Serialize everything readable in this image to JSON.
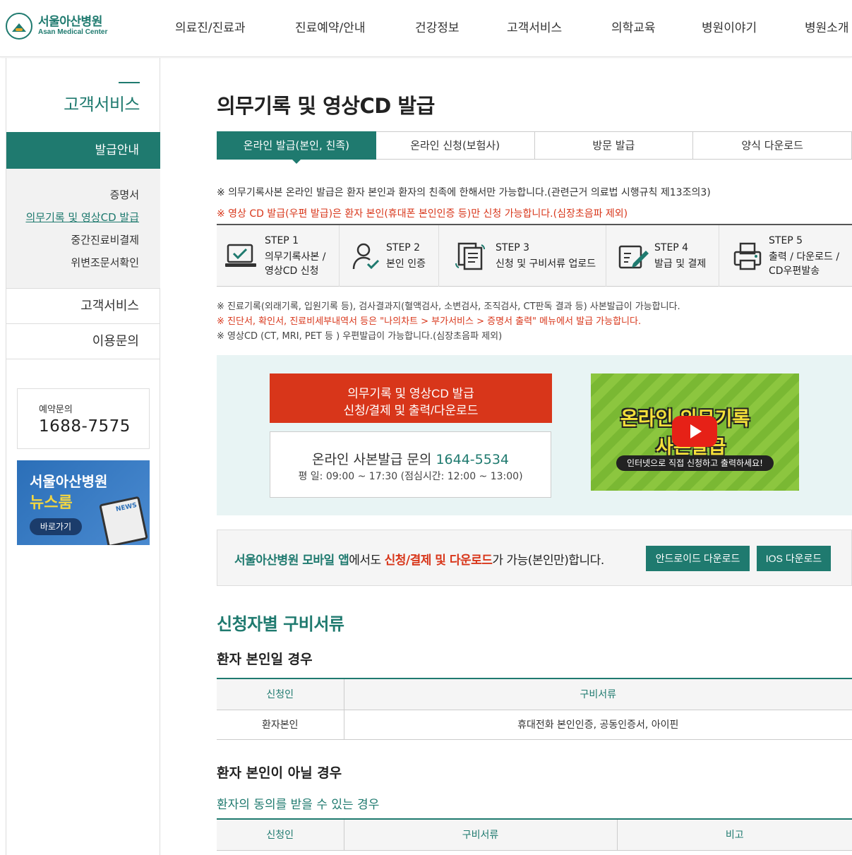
{
  "header": {
    "logo_kr": "서울아산병원",
    "logo_en": "Asan Medical Center",
    "nav": [
      "의료진/진료과",
      "진료예약/안내",
      "건강정보",
      "고객서비스",
      "의학교육",
      "병원이야기",
      "병원소개"
    ]
  },
  "sidebar": {
    "title": "고객서비스",
    "active": "발급안내",
    "sub_items": [
      "증명서",
      "의무기록 및 영상CD 발급",
      "중간진료비결제",
      "위변조문서확인"
    ],
    "items": [
      "고객서비스",
      "이용문의"
    ],
    "phone_label": "예약문의",
    "phone_number": "1688-7575",
    "newsroom_title1": "서울아산병원",
    "newsroom_title2": "뉴스룸",
    "newsroom_button": "바로가기",
    "newsroom_paper": "NEWS"
  },
  "main": {
    "title": "의무기록 및 영상CD 발급",
    "tabs": [
      "온라인 발급(본인, 친족)",
      "온라인 신청(보험사)",
      "방문 발급",
      "양식 다운로드"
    ],
    "note1": "※ 의무기록사본 온라인 발급은 환자 본인과 환자의 친족에 한해서만 가능합니다.(관련근거 의료법 시행규칙 제13조의3)",
    "note2": "※ 영상 CD 발급(우편 발급)은 환자 본인(휴대폰 본인인증 등)만 신청 가능합니다.(심장초음파 제외)",
    "steps": [
      {
        "no": "STEP 1",
        "line1": "의무기록사본 /",
        "line2": "영상CD 신청"
      },
      {
        "no": "STEP 2",
        "line1": "본인 인증",
        "line2": ""
      },
      {
        "no": "STEP 3",
        "line1": "신청 및 구비서류 업로드",
        "line2": ""
      },
      {
        "no": "STEP 4",
        "line1": "발급 및 결제",
        "line2": ""
      },
      {
        "no": "STEP 5",
        "line1": "출력 / 다운로드 /",
        "line2": "CD우편발송"
      }
    ],
    "notes_small": [
      "※ 진료기록(외래기록, 입원기록 등), 검사결과지(혈액검사, 소변검사, 조직검사, CT판독 결과 등) 사본발급이 가능합니다.",
      "※ 진단서, 확인서, 진료비세부내역서 등은 \"나의차트 > 부가서비스 > 증명서 출력\" 메뉴에서 발급 가능합니다.",
      "※ 영상CD (CT, MRI, PET 등 ) 우편발급이 가능합니다.(심장초음파 제외)"
    ],
    "cta_line1": "의무기록 및 영상CD 발급",
    "cta_line2": "신청/결제 및 출력/다운로드",
    "info_prefix": "온라인 사본발급 문의",
    "info_tel": "1644-5534",
    "info_hours": "평 일: 09:00 ~ 17:30 (점심시간: 12:00 ~ 13:00)",
    "video_line1": "온라인 의무기록",
    "video_line2": "사본발급",
    "video_sub": "인터넷으로 직접 신청하고 출력하세요!",
    "app_teal": "서울아산병원 모바일 앱",
    "app_mid": "에서도 ",
    "app_red": "신청/결제 및 다운로드",
    "app_end": "가 가능(본인만)합니다.",
    "android_btn": "안드로이드 다운로드",
    "ios_btn": "IOS 다운로드",
    "section_title": "신청자별 구비서류",
    "sub_title1": "환자 본인일 경우",
    "table1": {
      "headers": [
        "신청인",
        "구비서류"
      ],
      "rows": [
        [
          "환자본인",
          "휴대전화 본인인증, 공동인증서, 아이핀"
        ]
      ]
    },
    "sub_title2": "환자 본인이 아닐 경우",
    "sub_sub_title": "환자의 동의를 받을 수 있는 경우",
    "table2": {
      "headers": [
        "신청인",
        "구비서류",
        "비고"
      ]
    }
  },
  "colors": {
    "primary": "#1f7a6f",
    "accent_red": "#d8361a",
    "cta_bg": "#e8f4f4"
  }
}
